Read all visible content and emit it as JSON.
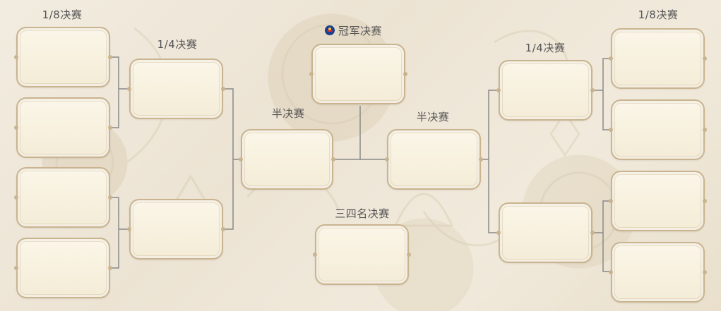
{
  "labels": {
    "round16_left": "1/8决赛",
    "round16_right": "1/8决赛",
    "quarter_left": "1/4决赛",
    "quarter_right": "1/4决赛",
    "semi_left": "半决赛",
    "semi_right": "半决赛",
    "final": "冠军决赛",
    "third_place": "三四名决赛"
  },
  "icons": {
    "final_icon": "world-cup-emblem-icon"
  },
  "colors": {
    "slot_border": "#c9b48f",
    "connector": "#8a8a8a",
    "label_text": "#555555"
  }
}
